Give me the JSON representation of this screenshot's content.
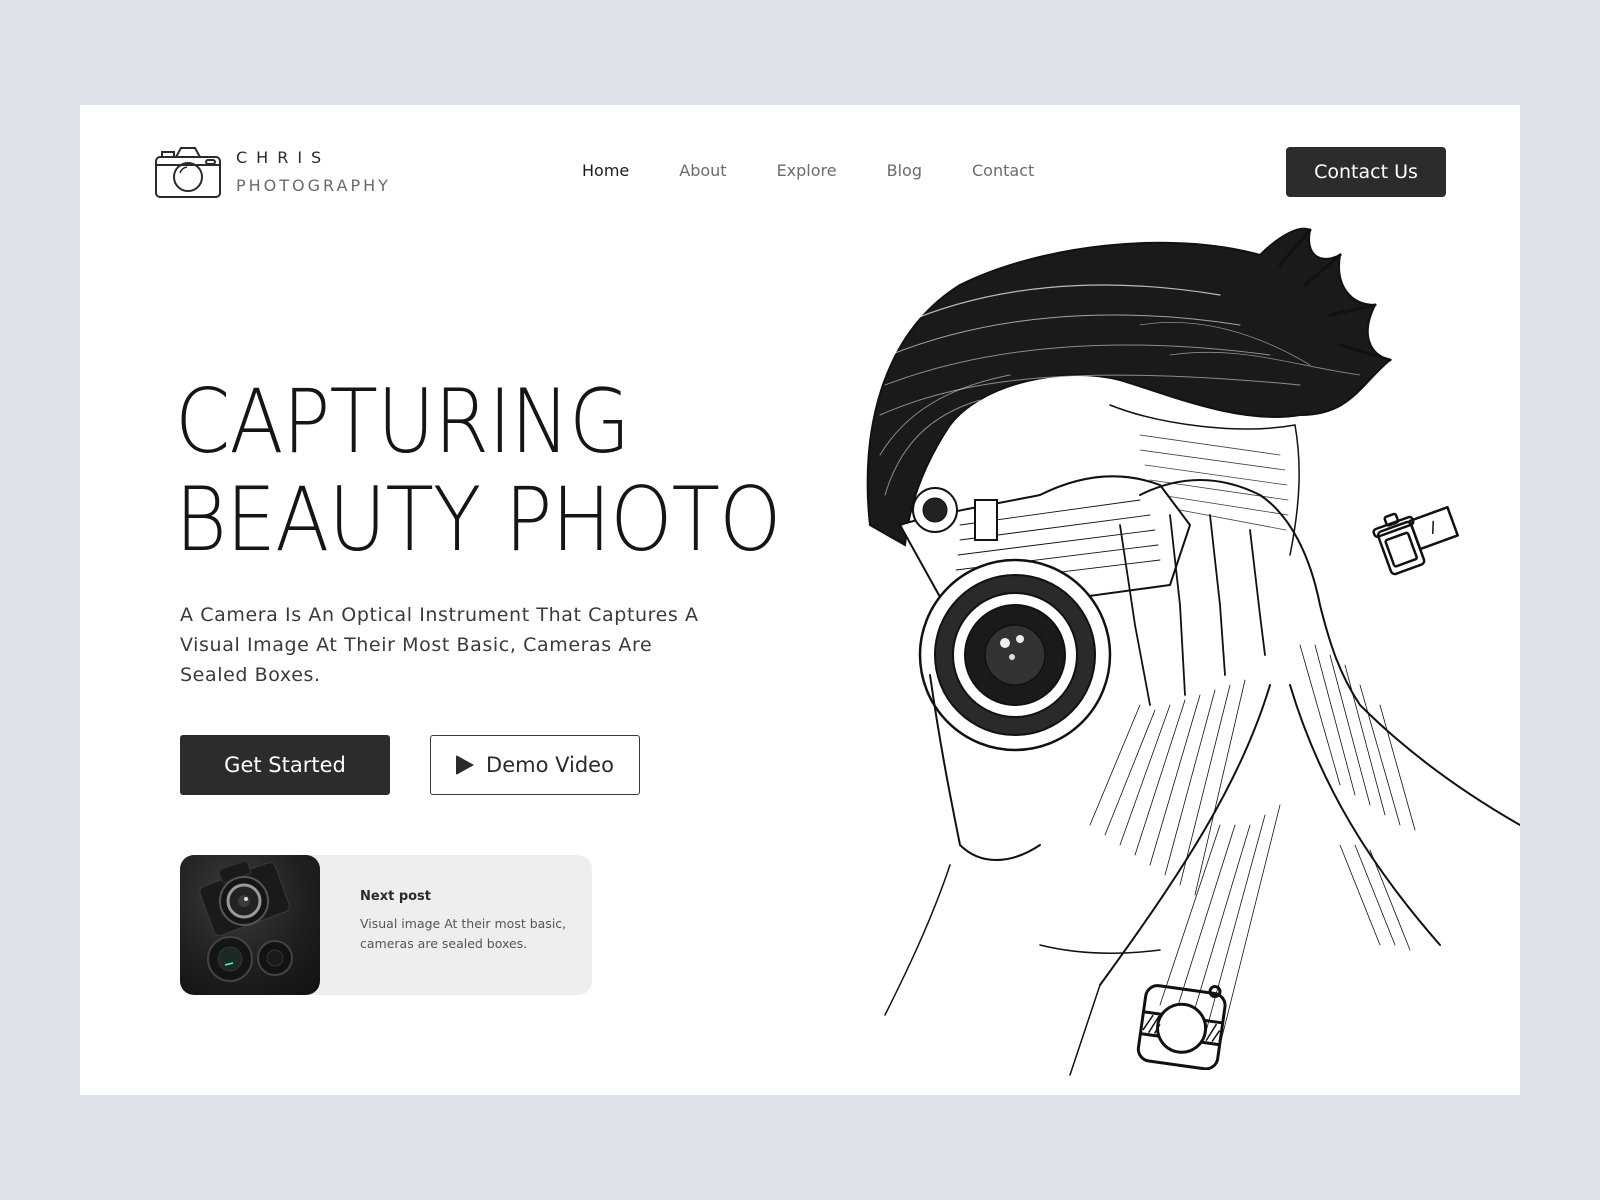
{
  "brand": {
    "line1": "CHRIS",
    "line2": "PHOTOGRAPHY",
    "icon": "camera-icon"
  },
  "nav": {
    "items": [
      {
        "label": "Home",
        "active": true
      },
      {
        "label": "About",
        "active": false
      },
      {
        "label": "Explore",
        "active": false
      },
      {
        "label": "Blog",
        "active": false
      },
      {
        "label": "Contact",
        "active": false
      }
    ],
    "cta_label": "Contact Us"
  },
  "hero": {
    "title_line1": "CAPTURING",
    "title_line2": "BEAUTY PHOTO",
    "description": "A Camera Is An Optical Instrument That Captures A Visual Image At Their Most Basic, Cameras Are Sealed Boxes.",
    "primary_button": "Get Started",
    "secondary_button": "Demo Video",
    "secondary_icon": "play-icon"
  },
  "next_post": {
    "title": "Next post",
    "body": "Visual image At their most basic, cameras are sealed boxes.",
    "thumbnail": "camera-lenses-photo"
  },
  "illustration": {
    "subject": "sketch-photographer-with-camera",
    "decorations": [
      "film-roll-icon",
      "instant-camera-icon"
    ]
  },
  "colors": {
    "page_background": "#dfe2e9",
    "card_background": "#ffffff",
    "primary_dark": "#2b2c2e",
    "next_post_background": "#eeeeee"
  }
}
